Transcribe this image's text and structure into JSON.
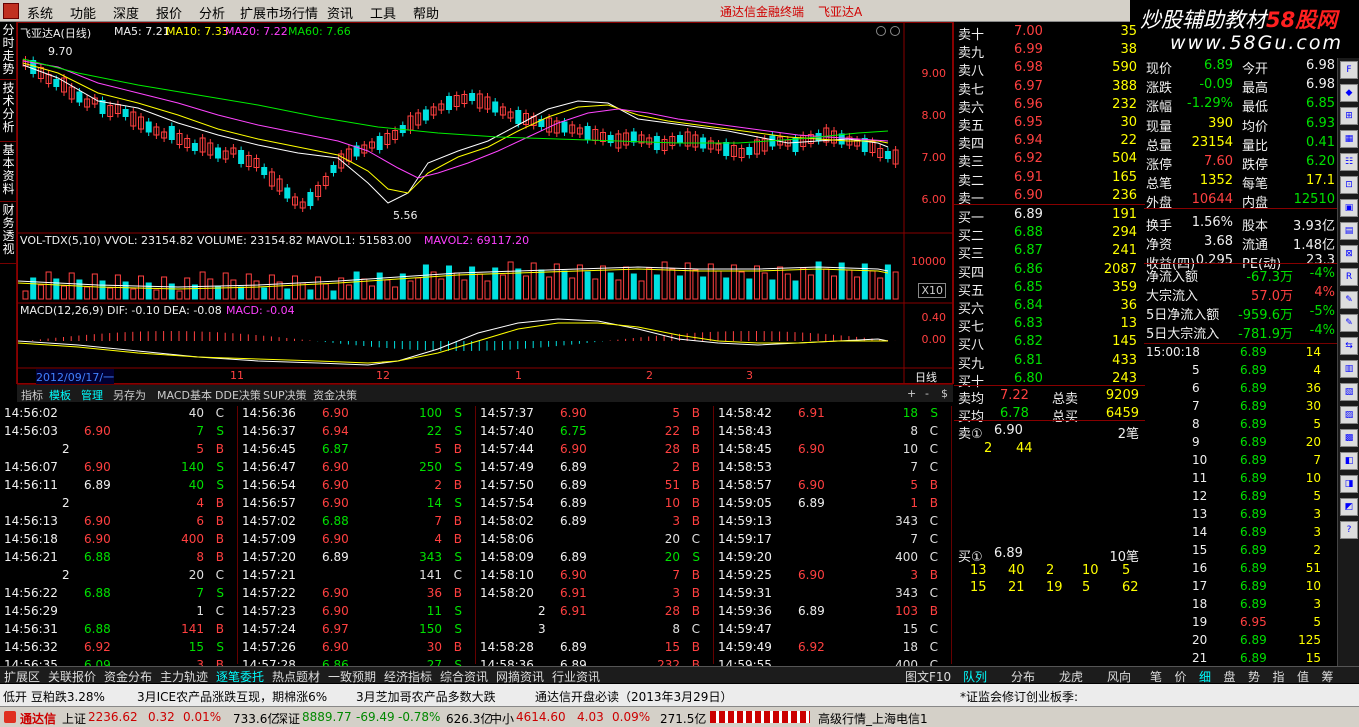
{
  "menu": {
    "items": [
      "系统",
      "功能",
      "深度",
      "报价",
      "分析",
      "扩展市场行情",
      "资讯",
      "工具",
      "帮助"
    ],
    "brand": "通达信金融终端",
    "stock": "飞亚达A"
  },
  "watermark": {
    "line1_a": "炒股辅助教材",
    "line1_b": "58股网",
    "line2": "www.58Gu.com"
  },
  "left_tabs": [
    "分时走势",
    "技术分析",
    "基本资料",
    "财务透视"
  ],
  "chart": {
    "title_line": "飞亚达A(日线)",
    "ma5": "MA5: 7.21",
    "ma10": "MA10: 7.33",
    "ma20": "MA20: 7.22",
    "ma60": "MA60: 7.66",
    "high_mark": "9.70",
    "low_mark": "5.56",
    "price_axis": [
      "9.00",
      "8.00",
      "7.00",
      "6.00"
    ],
    "vol_line_a": "VOL-TDX(5,10) VVOL: 23154.82  VOLUME: 23154.82  MAVOL1: 51583.00",
    "vol_line_b": "MAVOL2: 69117.20",
    "vol_axis": "10000",
    "vol_unit": "X10",
    "macd_line_a": "MACD(12,26,9)  DIF: -0.10  DEA: -0.08",
    "macd_line_b": "MACD: -0.04",
    "macd_axis": [
      "0.40",
      "0.00"
    ],
    "date_label": "2012/09/17/一",
    "date_ticks": [
      "11",
      "12",
      "1",
      "2",
      "3"
    ],
    "period": "日线",
    "tabs": [
      "指标",
      "模板",
      "管理",
      "另存为",
      "MACD基本",
      "DDE决策",
      "SUP决策",
      "资金决策"
    ]
  },
  "ticks": [
    [
      [
        "14:56:02",
        "",
        "40",
        "C"
      ],
      [
        "14:56:03",
        "6.90",
        "7",
        "S"
      ],
      [
        "",
        "2",
        "5",
        "B"
      ],
      [
        "14:56:07",
        "6.90",
        "140",
        "S"
      ],
      [
        "14:56:11",
        "6.89",
        "40",
        "S"
      ],
      [
        "",
        "2",
        "4",
        "B"
      ],
      [
        "14:56:13",
        "6.90",
        "6",
        "B"
      ],
      [
        "14:56:18",
        "6.90",
        "400",
        "B"
      ],
      [
        "14:56:21",
        "6.88",
        "8",
        "B"
      ],
      [
        "",
        "2",
        "20",
        "C"
      ],
      [
        "14:56:22",
        "6.88",
        "7",
        "S"
      ],
      [
        "14:56:29",
        "",
        "1",
        "C"
      ],
      [
        "14:56:31",
        "6.88",
        "141",
        "B"
      ],
      [
        "14:56:32",
        "6.92",
        "15",
        "S"
      ],
      [
        "14:56:35",
        "6.09",
        "3",
        "B"
      ]
    ],
    [
      [
        "14:56:36",
        "6.90",
        "100",
        "S"
      ],
      [
        "14:56:37",
        "6.94",
        "22",
        "S"
      ],
      [
        "14:56:45",
        "6.87",
        "5",
        "B"
      ],
      [
        "14:56:47",
        "6.90",
        "250",
        "S"
      ],
      [
        "14:56:54",
        "6.90",
        "2",
        "B"
      ],
      [
        "14:56:57",
        "6.90",
        "14",
        "S"
      ],
      [
        "14:57:02",
        "6.88",
        "7",
        "B"
      ],
      [
        "14:57:09",
        "6.90",
        "4",
        "B"
      ],
      [
        "14:57:20",
        "6.89",
        "343",
        "S"
      ],
      [
        "14:57:21",
        "",
        "141",
        "C"
      ],
      [
        "14:57:22",
        "6.90",
        "36",
        "B"
      ],
      [
        "14:57:23",
        "6.90",
        "11",
        "S"
      ],
      [
        "14:57:24",
        "6.97",
        "150",
        "S"
      ],
      [
        "14:57:26",
        "6.90",
        "30",
        "B"
      ],
      [
        "14:57:28",
        "6.86",
        "27",
        "S"
      ]
    ],
    [
      [
        "14:57:37",
        "6.90",
        "5",
        "B"
      ],
      [
        "14:57:40",
        "6.75",
        "22",
        "B"
      ],
      [
        "14:57:44",
        "6.90",
        "28",
        "B"
      ],
      [
        "14:57:49",
        "6.89",
        "2",
        "B"
      ],
      [
        "14:57:50",
        "6.89",
        "51",
        "B"
      ],
      [
        "14:57:54",
        "6.89",
        "10",
        "B"
      ],
      [
        "14:58:02",
        "6.89",
        "3",
        "B"
      ],
      [
        "14:58:06",
        "",
        "20",
        "C"
      ],
      [
        "14:58:09",
        "6.89",
        "20",
        "S"
      ],
      [
        "14:58:10",
        "6.90",
        "7",
        "B"
      ],
      [
        "14:58:20",
        "6.91",
        "3",
        "B"
      ],
      [
        "",
        "2",
        "6.91",
        "28",
        "B"
      ],
      [
        "",
        "3",
        "8",
        "C"
      ],
      [
        "14:58:28",
        "6.89",
        "15",
        "B"
      ],
      [
        "14:58:36",
        "6.89",
        "232",
        "B"
      ]
    ],
    [
      [
        "14:58:42",
        "6.91",
        "18",
        "S"
      ],
      [
        "14:58:43",
        "",
        "8",
        "C"
      ],
      [
        "14:58:45",
        "6.90",
        "10",
        "C"
      ],
      [
        "14:58:53",
        "",
        "7",
        "C"
      ],
      [
        "14:58:57",
        "6.90",
        "5",
        "B"
      ],
      [
        "14:59:05",
        "6.89",
        "1",
        "B"
      ],
      [
        "14:59:13",
        "",
        "343",
        "C"
      ],
      [
        "14:59:17",
        "",
        "7",
        "C"
      ],
      [
        "14:59:20",
        "",
        "400",
        "C"
      ],
      [
        "14:59:25",
        "6.90",
        "3",
        "B"
      ],
      [
        "14:59:31",
        "",
        "343",
        "C"
      ],
      [
        "14:59:36",
        "6.89",
        "103",
        "B"
      ],
      [
        "14:59:47",
        "",
        "15",
        "C"
      ],
      [
        "14:59:49",
        "6.92",
        "18",
        "C"
      ],
      [
        "14:59:55",
        "",
        "400",
        "C"
      ]
    ]
  ],
  "modtabs": [
    "扩展区",
    "关联报价",
    "资金分布",
    "主力轨迹",
    "逐笔委托",
    "热点题材",
    "一致预期",
    "经济指标",
    "综合资讯",
    "网摘资讯",
    "行业资讯"
  ],
  "figure_btn": "图文F10",
  "book": {
    "asks": [
      [
        "卖十",
        "7.00",
        "35"
      ],
      [
        "卖九",
        "6.99",
        "38"
      ],
      [
        "卖八",
        "6.98",
        "590"
      ],
      [
        "卖七",
        "6.97",
        "388"
      ],
      [
        "卖六",
        "6.96",
        "232"
      ],
      [
        "卖五",
        "6.95",
        "30"
      ],
      [
        "卖四",
        "6.94",
        "22"
      ],
      [
        "卖三",
        "6.92",
        "504"
      ],
      [
        "卖二",
        "6.91",
        "165"
      ],
      [
        "卖一",
        "6.90",
        "236"
      ]
    ],
    "bids": [
      [
        "买一",
        "6.89",
        "191"
      ],
      [
        "买二",
        "6.88",
        "294"
      ],
      [
        "买三",
        "6.87",
        "241"
      ],
      [
        "买四",
        "6.86",
        "2087"
      ],
      [
        "买五",
        "6.85",
        "359"
      ],
      [
        "买六",
        "6.84",
        "36"
      ],
      [
        "买七",
        "6.83",
        "13"
      ],
      [
        "买八",
        "6.82",
        "145"
      ],
      [
        "买九",
        "6.81",
        "433"
      ],
      [
        "买十",
        "6.80",
        "243"
      ]
    ],
    "avg_sell": [
      "卖均",
      "7.22",
      "总卖",
      "9209"
    ],
    "avg_buy": [
      "买均",
      "6.78",
      "总买",
      "6459"
    ],
    "sell1": [
      "卖①",
      "6.90",
      "2笔"
    ],
    "sell1_q": [
      "2",
      "44"
    ],
    "buy1": [
      "买①",
      "6.89",
      "10笔"
    ],
    "buy1_q1": [
      "13",
      "40",
      "2",
      "10",
      "5"
    ],
    "buy1_q2": [
      "15",
      "21",
      "19",
      "5",
      "62"
    ]
  },
  "stats": [
    [
      "现价",
      "6.89",
      "今开",
      "6.98"
    ],
    [
      "涨跌",
      "-0.09",
      "最高",
      "6.98"
    ],
    [
      "涨幅",
      "-1.29%",
      "最低",
      "6.85"
    ],
    [
      "现量",
      "390",
      "均价",
      "6.93"
    ],
    [
      "总量",
      "23154",
      "量比",
      "0.41"
    ],
    [
      "涨停",
      "7.60",
      "跌停",
      "6.20"
    ],
    [
      "总笔",
      "1352",
      "每笔",
      "17.1"
    ],
    [
      "外盘",
      "10644",
      "内盘",
      "12510"
    ],
    [
      "换手",
      "1.56%",
      "股本",
      "3.93亿"
    ],
    [
      "净资",
      "3.68",
      "流通",
      "1.48亿"
    ],
    [
      "收益(四)",
      "0.295",
      "PE(动)",
      "23.3"
    ]
  ],
  "flows": [
    [
      "净流入额",
      "-67.3万",
      "-4%"
    ],
    [
      "大宗流入",
      "57.0万",
      "4%"
    ],
    [
      "5日净流入额",
      "-959.6万",
      "-5%"
    ],
    [
      "5日大宗流入",
      "-781.9万",
      "-4%"
    ]
  ],
  "minute_ticks": [
    [
      "15:00:18",
      "6.89",
      "14"
    ],
    [
      "5",
      "6.89",
      "4"
    ],
    [
      "6",
      "6.89",
      "36"
    ],
    [
      "7",
      "6.89",
      "30"
    ],
    [
      "8",
      "6.89",
      "5"
    ],
    [
      "9",
      "6.89",
      "20"
    ],
    [
      "10",
      "6.89",
      "7"
    ],
    [
      "11",
      "6.89",
      "10"
    ],
    [
      "12",
      "6.89",
      "5"
    ],
    [
      "13",
      "6.89",
      "3"
    ],
    [
      "14",
      "6.89",
      "3"
    ],
    [
      "15",
      "6.89",
      "2"
    ],
    [
      "16",
      "6.89",
      "51"
    ],
    [
      "17",
      "6.89",
      "10"
    ],
    [
      "18",
      "6.89",
      "3"
    ],
    [
      "19",
      "6.95",
      "5"
    ],
    [
      "20",
      "6.89",
      "125"
    ],
    [
      "21",
      "6.89",
      "15"
    ]
  ],
  "rtabs": [
    "队列",
    "分布",
    "龙虎",
    "风向"
  ],
  "mtabs": [
    "笔",
    "价",
    "细",
    "盘",
    "势",
    "指",
    "值",
    "筹"
  ],
  "news": [
    "低开 豆粕跌3.28%",
    "3月ICE农产品涨跌互现，期棉涨6%",
    "3月芝加哥农产品多数大跌",
    "通达信开盘必读（2013年3月29日）",
    "*证监会修订创业板季:"
  ],
  "status": {
    "app": "通达信",
    "sh_label": "上证",
    "sh_val": "2236.62",
    "sh_chg": "0.32",
    "sh_pct": "0.01%",
    "sh_amt": "733.6亿",
    "sz_label": "深证",
    "sz_val": "8889.77",
    "sz_chg": "-69.49",
    "sz_pct": "-0.78%",
    "sz_amt": "626.3亿",
    "zx_label": "中小",
    "zx_val": "4614.60",
    "zx_chg": "4.03",
    "zx_pct": "0.09%",
    "zx_amt": "271.5亿",
    "server": "高级行情_上海电信1"
  },
  "colors": {
    "up": "#ff4040",
    "down": "#00e000",
    "neutral": "#f0f0f0",
    "ma5": "#ffffff",
    "ma10": "#ffff00",
    "ma20": "#ff40ff",
    "ma60": "#00e000"
  }
}
